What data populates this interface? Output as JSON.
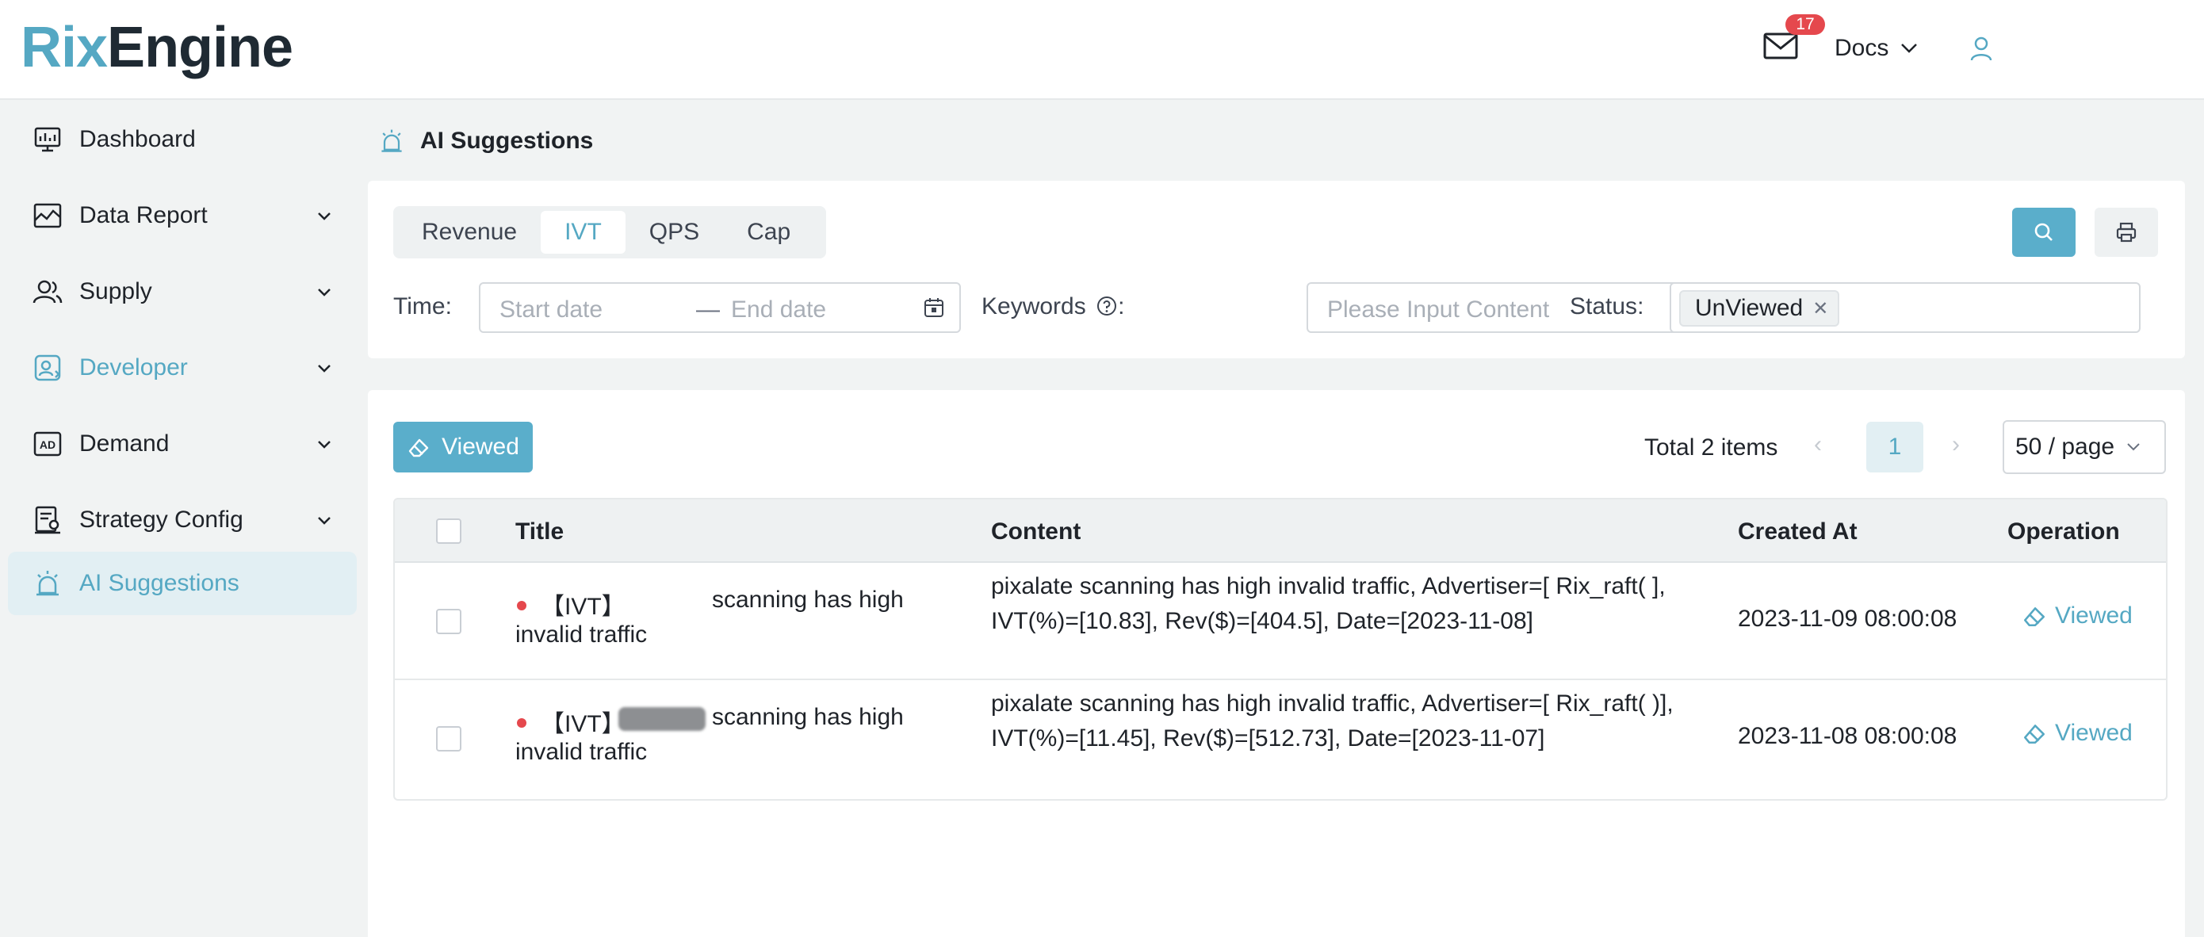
{
  "header": {
    "logo_part1": "Rix",
    "logo_part2": "Engine",
    "mail_count": "17",
    "docs_label": "Docs"
  },
  "sidebar": {
    "items": [
      {
        "label": "Dashboard",
        "icon": "dashboard-icon"
      },
      {
        "label": "Data Report",
        "icon": "report-icon"
      },
      {
        "label": "Supply",
        "icon": "users-icon"
      },
      {
        "label": "Developer",
        "icon": "developer-icon"
      },
      {
        "label": "Demand",
        "icon": "ad-icon"
      },
      {
        "label": "Strategy Config",
        "icon": "strategy-icon"
      },
      {
        "label": "AI Suggestions",
        "icon": "alarm-icon"
      }
    ]
  },
  "page": {
    "title": "AI Suggestions"
  },
  "filters": {
    "tabs": [
      "Revenue",
      "IVT",
      "QPS",
      "Cap"
    ],
    "active_tab": "IVT",
    "time_label": "Time",
    "start_placeholder": "Start date",
    "date_separator": "—",
    "end_placeholder": "End date",
    "keywords_label": "Keywords",
    "keywords_placeholder": "Please Input Content",
    "status_label": "Status",
    "status_tag": "UnViewed",
    "colon": ":"
  },
  "toolbar": {
    "viewed_button": "Viewed",
    "total": "Total 2 items",
    "page": "1",
    "page_size": "50 / page"
  },
  "table": {
    "columns": [
      "Title",
      "Content",
      "Created At",
      "Operation"
    ],
    "rows": [
      {
        "title_prefix": "【IVT】",
        "title_suffix": "scanning has high",
        "title_line2": "invalid traffic",
        "content": "pixalate scanning has high invalid traffic, Advertiser=[ Rix_raft(      ], IVT(%)=[10.83], Rev($)=[404.5], Date=[2023-11-08]",
        "created_at": "2023-11-09 08:00:08",
        "operation": "Viewed"
      },
      {
        "title_prefix": "【IVT】",
        "title_suffix": "scanning has high",
        "title_line2": "invalid traffic",
        "content": "pixalate scanning has high invalid traffic, Advertiser=[ Rix_raft(      )], IVT(%)=[11.45], Rev($)=[512.73], Date=[2023-11-07]",
        "created_at": "2023-11-08 08:00:08",
        "operation": "Viewed"
      }
    ]
  },
  "colors": {
    "accent": "#55a8c3",
    "button": "#5aaecb",
    "badge": "#e5484d",
    "active_bg": "#e2eff3"
  }
}
